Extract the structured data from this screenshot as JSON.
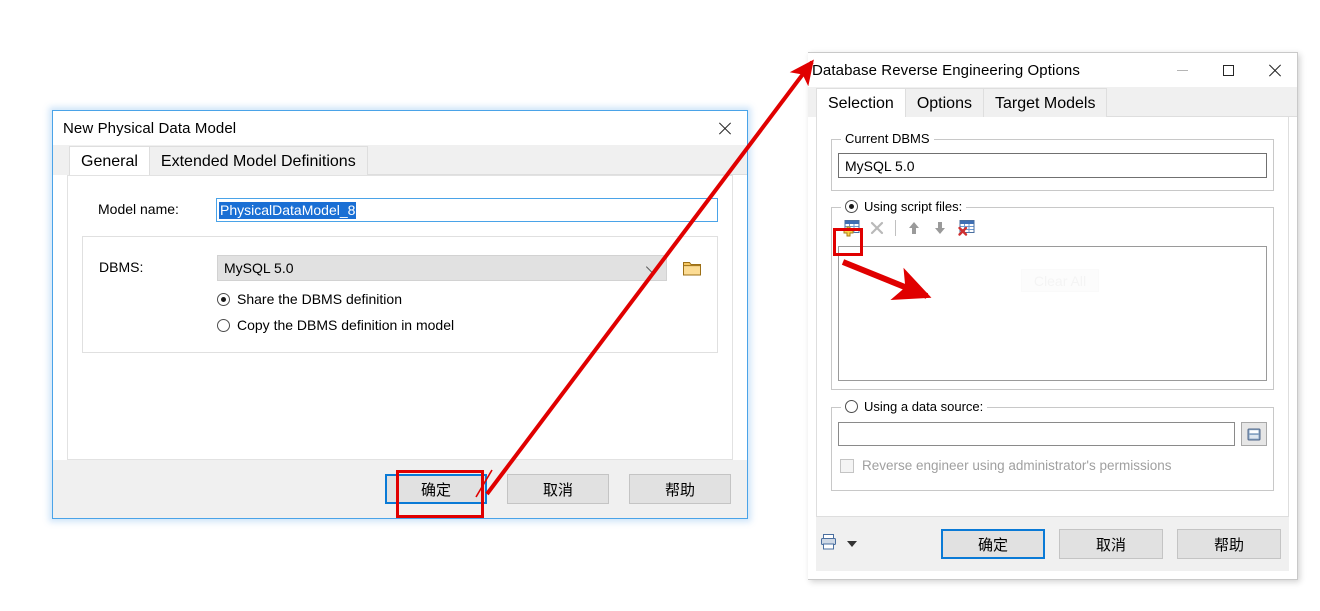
{
  "left_dialog": {
    "title": "New Physical Data Model",
    "close_icon": "close-icon",
    "tabs": [
      {
        "label": "General",
        "active": true
      },
      {
        "label": "Extended Model Definitions",
        "active": false
      }
    ],
    "model_name": {
      "label": "Model name:",
      "value": "PhysicalDataModel_8",
      "selected": true
    },
    "dbms_group": {
      "label": "DBMS:",
      "combo_value": "MySQL 5.0",
      "browse_icon": "folder-icon",
      "options": [
        {
          "label": "Share the DBMS definition",
          "checked": true
        },
        {
          "label": "Copy the DBMS definition in model",
          "checked": false
        }
      ]
    },
    "buttons": [
      {
        "label": "确定",
        "default": true,
        "name": "ok-button"
      },
      {
        "label": "取消",
        "default": false,
        "name": "cancel-button"
      },
      {
        "label": "帮助",
        "default": false,
        "name": "help-button"
      }
    ]
  },
  "right_dialog": {
    "title": "Database Reverse Engineering Options",
    "window_controls": [
      "minimize-icon",
      "maximize-icon",
      "close-icon"
    ],
    "tabs": [
      {
        "label": "Selection",
        "active": true
      },
      {
        "label": "Options",
        "active": false
      },
      {
        "label": "Target Models",
        "active": false
      }
    ],
    "current_dbms": {
      "legend": "Current DBMS",
      "value": "MySQL 5.0"
    },
    "script_files": {
      "legend": "Using script files:",
      "checked": true,
      "toolbar": [
        {
          "name": "add-script-icon",
          "enabled": true
        },
        {
          "name": "delete-script-icon",
          "enabled": false
        },
        {
          "name": "move-up-icon",
          "enabled": true
        },
        {
          "name": "move-down-icon",
          "enabled": true
        },
        {
          "name": "clear-all-icon",
          "enabled": true
        }
      ],
      "list_items": [],
      "ghost_button_label": "Clear All"
    },
    "data_source": {
      "legend": "Using a data source:",
      "checked": false,
      "input_value": "",
      "picker_icon": "data-source-icon",
      "checkbox_label": "Reverse engineer using administrator's permissions",
      "checkbox_checked": false,
      "checkbox_enabled": false
    },
    "footer": {
      "print_icon": "printer-icon",
      "dropdown_icon": "caret-down-icon",
      "buttons": [
        {
          "label": "确定",
          "default": true,
          "name": "ok-button"
        },
        {
          "label": "取消",
          "default": false,
          "name": "cancel-button"
        },
        {
          "label": "帮助",
          "default": false,
          "name": "help-button"
        }
      ]
    }
  },
  "annotations": {
    "accent_color": "#e00000",
    "highlight_ok_button": "确定",
    "highlight_add_script_button": "add-script-icon"
  }
}
